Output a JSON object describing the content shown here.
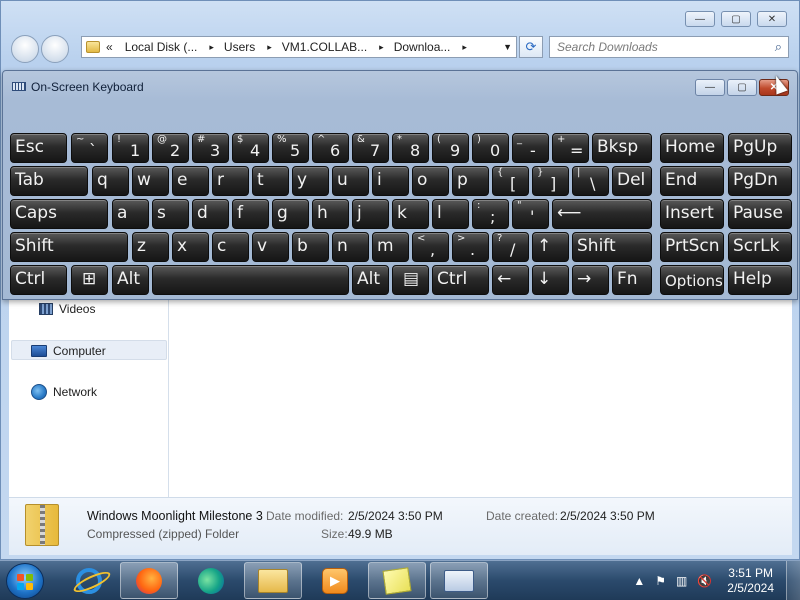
{
  "explorer": {
    "controls": {
      "minimize": "—",
      "maximize": "▢",
      "close": "✕"
    },
    "address": {
      "back_chevron": "«",
      "crumbs": [
        "Local Disk (...",
        "Users",
        "VM1.COLLAB...",
        "Downloa..."
      ],
      "separator": "▸"
    },
    "search_placeholder": "Search Downloads",
    "nav": {
      "videos": "Videos",
      "computer": "Computer",
      "network": "Network"
    },
    "details": {
      "name": "Windows Moonlight Milestone 3",
      "type": "Compressed (zipped) Folder",
      "modified_label": "Date modified:",
      "modified_value": "2/5/2024 3:50 PM",
      "size_label": "Size:",
      "size_value": "49.9 MB",
      "created_label": "Date created:",
      "created_value": "2/5/2024 3:50 PM"
    }
  },
  "osk": {
    "title": "On-Screen Keyboard",
    "controls": {
      "minimize": "—",
      "maximize": "▢",
      "close": "✕"
    },
    "keys": {
      "esc": "Esc",
      "tilde_sub": "~",
      "tilde_main": "`",
      "k1s": "!",
      "k1": "1",
      "k2s": "@",
      "k2": "2",
      "k3s": "#",
      "k3": "3",
      "k4s": "$",
      "k4": "4",
      "k5s": "%",
      "k5": "5",
      "k6s": "^",
      "k6": "6",
      "k7s": "&",
      "k7": "7",
      "k8s": "*",
      "k8": "8",
      "k9s": "(",
      "k9": "9",
      "k0s": ")",
      "k0": "0",
      "minus_s": "_",
      "minus": "-",
      "eq_s": "+",
      "eq": "=",
      "bksp": "Bksp",
      "home": "Home",
      "pgup": "PgUp",
      "tab": "Tab",
      "q": "q",
      "w": "w",
      "e": "e",
      "r": "r",
      "t": "t",
      "y": "y",
      "u": "u",
      "i": "i",
      "o": "o",
      "p": "p",
      "lbr_s": "{",
      "lbr": "[",
      "rbr_s": "}",
      "rbr": "]",
      "bs_s": "|",
      "bs": "\\",
      "del": "Del",
      "end": "End",
      "pgdn": "PgDn",
      "caps": "Caps",
      "a": "a",
      "s": "s",
      "d": "d",
      "f": "f",
      "g": "g",
      "h": "h",
      "j": "j",
      "k": "k",
      "l": "l",
      "semi_s": ":",
      "semi": ";",
      "quote_s": "\"",
      "quote": "'",
      "enter": "⟵",
      "insert": "Insert",
      "pause": "Pause",
      "lshift": "Shift",
      "z": "z",
      "x": "x",
      "c": "c",
      "v": "v",
      "b": "b",
      "n": "n",
      "m": "m",
      "comma_s": "<",
      "comma": ",",
      "dot_s": ">",
      "dot": ".",
      "slash_s": "?",
      "slash": "/",
      "up": "↑",
      "rshift": "Shift",
      "prtscn": "PrtScn",
      "scrlk": "ScrLk",
      "lctrl": "Ctrl",
      "win": "⊞",
      "lalt": "Alt",
      "space": "",
      "ralt": "Alt",
      "menu": "▤",
      "rctrl": "Ctrl",
      "left": "←",
      "down": "↓",
      "right": "→",
      "fn": "Fn",
      "options": "Options",
      "help": "Help"
    }
  },
  "taskbar": {
    "tray": {
      "flag": "⚑",
      "arrow": "▲",
      "volume": "🔇"
    },
    "time": "3:51 PM",
    "date": "2/5/2024"
  }
}
